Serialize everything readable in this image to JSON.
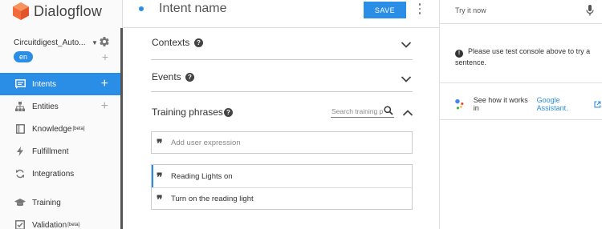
{
  "app": {
    "name": "Dialogflow"
  },
  "sidebar": {
    "agent_name": "Circuitdigest_Auto...",
    "language": "en",
    "items": [
      {
        "label": "Intents",
        "active": true,
        "has_add": true
      },
      {
        "label": "Entities",
        "active": false,
        "has_add": true
      },
      {
        "label": "Knowledge",
        "badge": "[beta]",
        "active": false
      },
      {
        "label": "Fulfillment",
        "active": false
      },
      {
        "label": "Integrations",
        "active": false
      },
      {
        "label": "Training",
        "active": false
      },
      {
        "label": "Validation",
        "badge": "[beta]",
        "active": false
      }
    ]
  },
  "header": {
    "intent_title": "Intent name",
    "save_label": "SAVE"
  },
  "sections": {
    "contexts": "Contexts",
    "events": "Events",
    "training": "Training phrases"
  },
  "training": {
    "search_placeholder": "Search training p",
    "add_placeholder": "Add user expression",
    "phrases": [
      "Reading Lights on",
      "Turn on the reading light"
    ]
  },
  "right_panel": {
    "try_label": "Try it now",
    "info_text": "Please use test console above to try a sentence.",
    "ga_text": "See how it works in",
    "ga_link": "Google Assistant."
  },
  "colors": {
    "accent": "#2b8ee6",
    "logo": "#f26b3a"
  }
}
